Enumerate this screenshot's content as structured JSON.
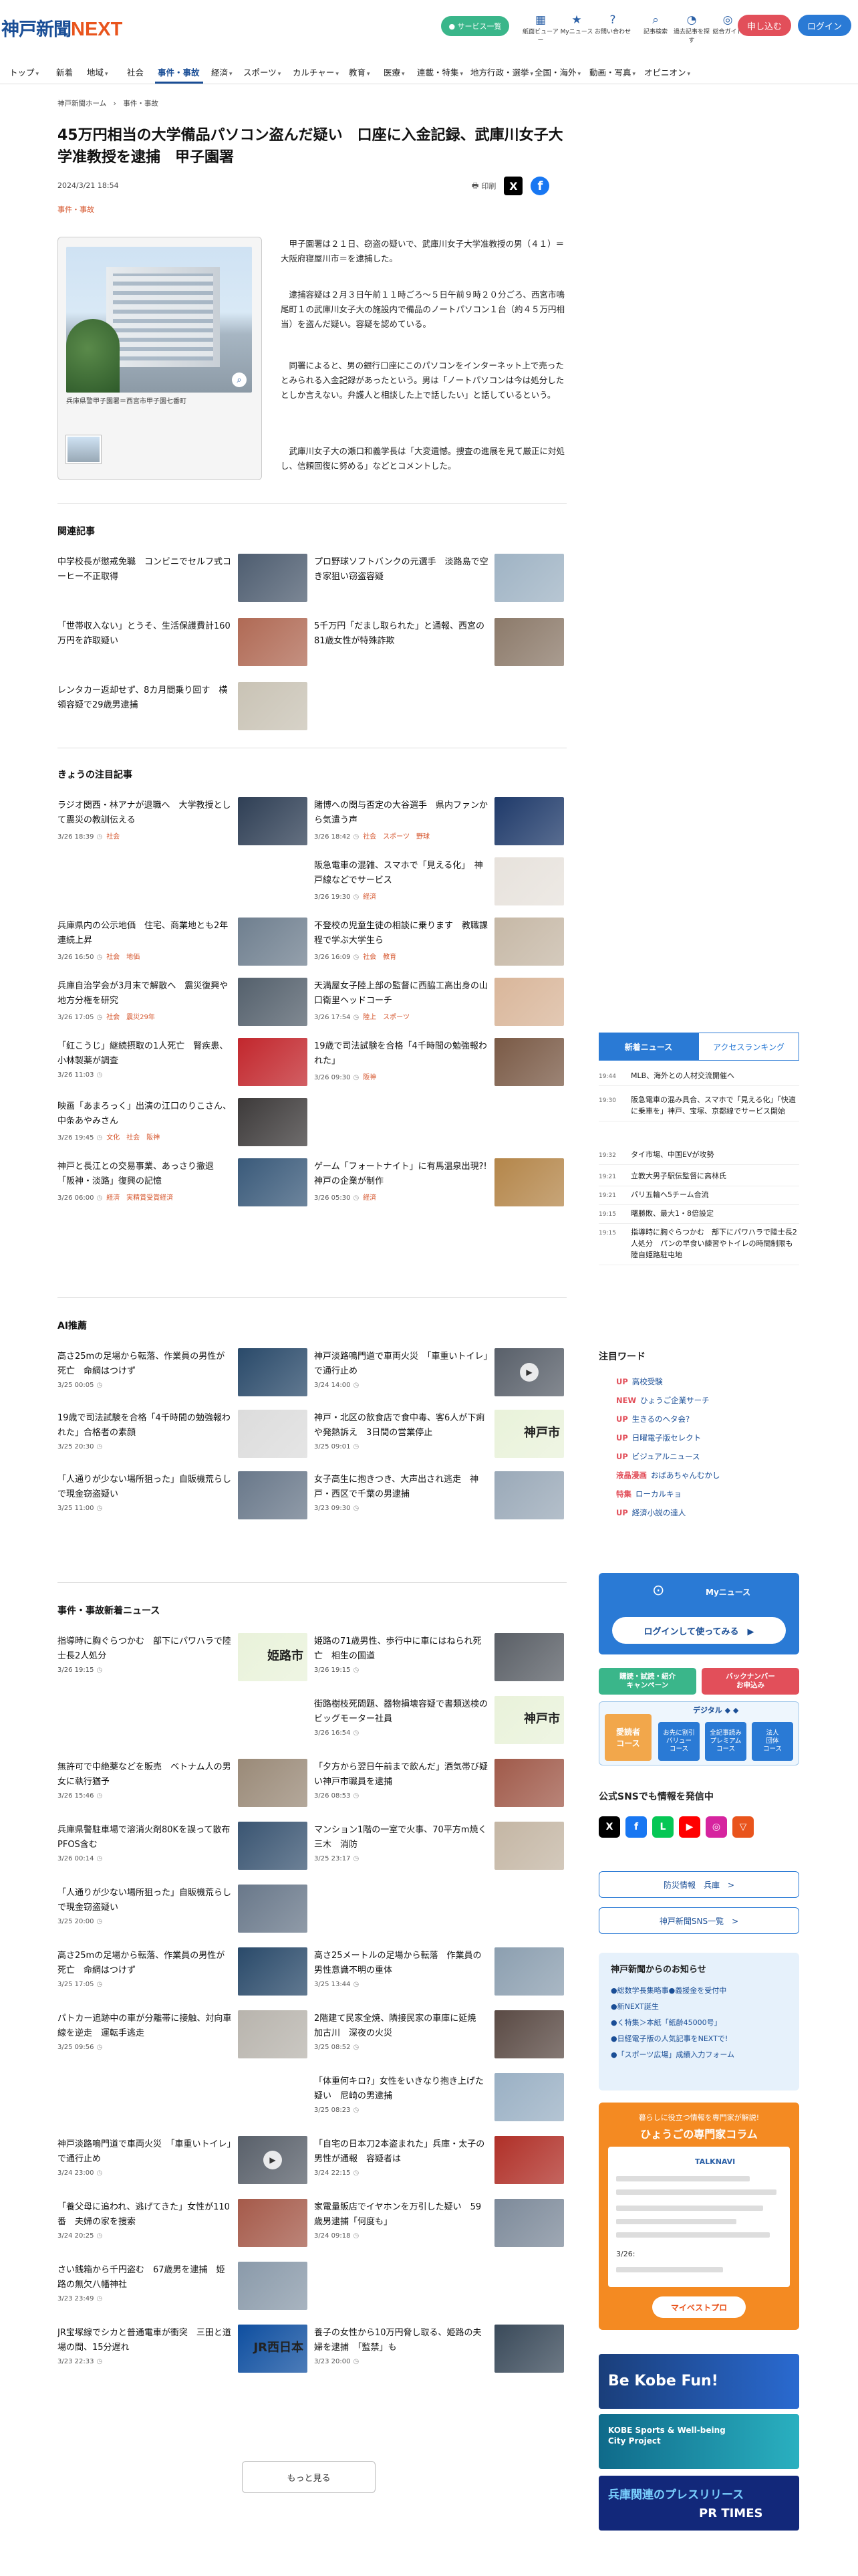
{
  "header": {
    "logo_text": "神戸新聞",
    "logo_next": "NEXT",
    "service_pill": "● サービス一覧",
    "icons": [
      {
        "glyph": "▦",
        "label": "紙面ビューアー"
      },
      {
        "glyph": "★",
        "label": "Myニュース"
      },
      {
        "glyph": "?",
        "label": "お問い合わせ"
      },
      {
        "glyph": "⌕",
        "label": "記事検索"
      },
      {
        "glyph": "◔",
        "label": "過去記事を探す"
      },
      {
        "glyph": "◎",
        "label": "総合ガイド"
      }
    ],
    "apply_label": "申し込む",
    "login_label": "ログイン"
  },
  "nav": {
    "items": [
      {
        "label": "トップ",
        "chev": "▾"
      },
      {
        "label": "新着",
        "chev": ""
      },
      {
        "label": "地域",
        "chev": "▾"
      },
      {
        "label": "社会",
        "chev": ""
      },
      {
        "label": "事件・事故",
        "chev": ""
      },
      {
        "label": "経済",
        "chev": "▾"
      },
      {
        "label": "スポーツ",
        "chev": "▾"
      },
      {
        "label": "カルチャー",
        "chev": "▾"
      },
      {
        "label": "教育",
        "chev": "▾"
      },
      {
        "label": "医療",
        "chev": "▾"
      },
      {
        "label": "連載・特集",
        "chev": "▾"
      },
      {
        "label": "地方行政・選挙",
        "chev": "▾"
      },
      {
        "label": "全国・海外",
        "chev": "▾"
      },
      {
        "label": "動画・写真",
        "chev": "▾"
      },
      {
        "label": "オピニオン",
        "chev": "▾"
      }
    ],
    "active_index": 4
  },
  "breadcrumb": "神戸新聞ホーム　›　事件・事故",
  "article": {
    "title": "45万円相当の大学備品パソコン盗んだ疑い　口座に入金記録、武庫川女子大学准教授を逮捕　甲子園署",
    "date": "2024/3/21 18:54",
    "category": "事件・事故",
    "print_label": "印刷",
    "photo_caption": "兵庫県警甲子園署＝西宮市甲子園七番町",
    "paragraphs": [
      "甲子園署は２１日、窃盗の疑いで、武庫川女子大学准教授の男（４１）＝大阪府寝屋川市＝を逮捕した。",
      "逮捕容疑は２月３日午前１１時ごろ～５日午前９時２０分ごろ、西宮市鳴尾町１の武庫川女子大の施設内で備品のノートパソコン１台（約４５万円相当）を盗んだ疑い。容疑を認めている。",
      "同署によると、男の銀行口座にこのパソコンをインターネット上で売ったとみられる入金記録があったという。男は「ノートパソコンは今は処分したとしか言えない。弁護人と相談した上で話したい」と話しているという。",
      "武庫川女子大の瀬口和義学長は「大変遺憾。捜査の進展を見て厳正に対処し、信頼回復に努める」などとコメントした。"
    ]
  },
  "sections": {
    "related": {
      "title": "関連記事",
      "cards": [
        {
          "title": "中学校長が懲戒免職　コンビニでセルフ式コーヒー不正取得",
          "meta": "",
          "tags": "",
          "img": "#4e5d70"
        },
        {
          "title": "プロ野球ソフトバンクの元選手　淡路島で空き家狙い窃盗容疑",
          "meta": "",
          "tags": "",
          "img": "#9fb3c4"
        },
        {
          "title": "「世帯収入ない」とうそ、生活保護費計160万円を詐取疑い",
          "meta": "",
          "tags": "",
          "img": "#b06a55"
        },
        {
          "title": "5千万円「だまし取られた」と通報、西宮の81歳女性が特殊詐欺",
          "meta": "",
          "tags": "",
          "img": "#8c7a6a"
        },
        {
          "title": "レンタカー返却せず、8カ月間乗り回す　横領容疑で29歳男逮捕",
          "meta": "",
          "tags": "",
          "img": "#c9c3b5"
        }
      ]
    },
    "featured": {
      "title": "きょうの注目記事",
      "cards": [
        {
          "title": "ラジオ関西・林アナが退職へ　大学教授として震災の教訓伝える",
          "meta": "3/26 18:39",
          "tags": "社会",
          "img": "#2f3f55"
        },
        {
          "title": "賭博への関与否定の大谷選手　県内ファンから気遣う声",
          "meta": "3/26 18:42",
          "tags": "社会　スポーツ　野球",
          "img": "#1f3a6a"
        },
        {
          "title": "",
          "meta": "",
          "tags": "",
          "img": ""
        },
        {
          "title": "阪急電車の混雑、スマホで「見える化」　神戸線などでサービス",
          "meta": "3/26 19:30",
          "tags": "経済",
          "img": "#e7e2dc"
        },
        {
          "title": "兵庫県内の公示地価　住宅、商業地とも2年連続上昇",
          "meta": "3/26 16:50",
          "tags": "社会　地価",
          "img": "#6f7f8f"
        },
        {
          "title": "不登校の児童生徒の相談に乗ります　教職課程で学ぶ大学生ら",
          "meta": "3/26 16:09",
          "tags": "社会　教育",
          "img": "#c6b8a6"
        },
        {
          "title": "兵庫自治学会が3月末で解散へ　震災復興や地方分権を研究",
          "meta": "3/26 17:05",
          "tags": "社会　震災29年",
          "img": "#54606c"
        },
        {
          "title": "天満屋女子陸上部の監督に西脇工高出身の山口衛里ヘッドコーチ",
          "meta": "3/26 17:54",
          "tags": "陸上　スポーツ",
          "img": "#d9b69a"
        },
        {
          "title": "「紅こうじ」継続摂取の1人死亡　腎疾患、小林製薬が調査",
          "meta": "3/26 11:03",
          "tags": "",
          "img": "#c2272d"
        },
        {
          "title": "19歳で司法試験を合格「4千時間の勉強報われた」",
          "meta": "3/26 09:30",
          "tags": "阪神",
          "img": "#7a5a46"
        },
        {
          "title": "映画「あまろっく」出演の江口のりこさん、中条あやみさん",
          "meta": "3/26 19:45",
          "tags": "文化　社会　阪神",
          "img": "#3d3a3a"
        },
        {
          "title": "",
          "meta": "",
          "tags": "",
          "img": ""
        },
        {
          "title": "神戸と長江との交易事業、あっさり撤退　「阪神・淡路」復興の記憶",
          "meta": "3/26 06:00",
          "tags": "経済　実精賞受賞経済",
          "img": "#3a5a7a"
        },
        {
          "title": "ゲーム「フォートナイト」に有馬温泉出現?!　神戸の企業が制作",
          "meta": "3/26 05:30",
          "tags": "経済",
          "img": "#b4864a"
        }
      ]
    },
    "ai": {
      "title": "AI推薦",
      "cards": [
        {
          "title": "高さ25mの足場から転落、作業員の男性が死亡　命綱はつけず",
          "meta": "3/25 00:05",
          "tags": "",
          "img": "#2a4a6a"
        },
        {
          "title": "神戸淡路鳴門道で車両火災　「車重いトイレ」で通行止め",
          "meta": "3/24 14:00",
          "tags": "",
          "img": "#59606a",
          "play": true
        },
        {
          "title": "19歳で司法試験を合格「4千時間の勉強報われた」合格者の素顔",
          "meta": "3/25 20:30",
          "tags": "",
          "img": "#dcdcdc"
        },
        {
          "title": "神戸・北区の飲食店で食中毒、客6人が下痢や発熱訴え　3日間の営業停止",
          "meta": "3/25 09:01",
          "tags": "",
          "img": "#e9f2da",
          "lbl": "神戸市"
        },
        {
          "title": "「人通りが少ない場所狙った」自販機荒らしで現金窃盗疑い",
          "meta": "3/25 11:00",
          "tags": "",
          "img": "#69788a"
        },
        {
          "title": "女子高生に抱きつき、大声出され逃走　神戸・西区で千葉の男逮捕",
          "meta": "3/23 09:30",
          "tags": "",
          "img": "#9aa9b8"
        }
      ]
    },
    "latest": {
      "title": "事件・事故新着ニュース",
      "cards": [
        {
          "title": "指導時に胸ぐらつかむ　部下にパワハラで陸士長2人処分",
          "meta": "3/26 19:15",
          "tags": "",
          "img": "#e9f2da",
          "lbl": "姫路市"
        },
        {
          "title": "姫路の71歳男性、歩行中に車にはねられ死亡　相生の国道",
          "meta": "3/26 19:15",
          "tags": "",
          "img": "#5a5f66"
        },
        {
          "title": "",
          "meta": "",
          "tags": "",
          "img": ""
        },
        {
          "title": "街路樹枝死問題、器物損壊容疑で書類送検のビッグモーター社員",
          "meta": "3/26 16:54",
          "tags": "",
          "img": "#e9f2da",
          "lbl": "神戸市"
        },
        {
          "title": "無許可で中絶薬などを販売　ベトナム人の男女に執行猶予",
          "meta": "3/26 15:46",
          "tags": "",
          "img": "#9a8a78"
        },
        {
          "title": "「夕方から翌日午前まで飲んだ」酒気帯び疑い神戸市職員を逮捕",
          "meta": "3/26 08:53",
          "tags": "",
          "img": "#a05a4a"
        },
        {
          "title": "兵庫県警駐車場で溶消火剤80Kを誤って散布　PFOS含む",
          "meta": "3/26 00:14",
          "tags": "",
          "img": "#3a5572"
        },
        {
          "title": "マンション1階の一室で火事、70平方m焼く　三木　消防",
          "meta": "3/25 23:17",
          "tags": "",
          "img": "#c4b6a4"
        },
        {
          "title": "「人通りが少ない場所狙った」自販機荒らしで現金窃盗疑い",
          "meta": "3/25 20:00",
          "tags": "",
          "img": "#69788a"
        },
        {
          "title": "",
          "meta": "",
          "tags": "",
          "img": ""
        },
        {
          "title": "高さ25mの足場から転落、作業員の男性が死亡　命綱はつけず",
          "meta": "3/25 17:05",
          "tags": "",
          "img": "#2a4a6a"
        },
        {
          "title": "高さ25メートルの足場から転落　作業員の男性意識不明の重体",
          "meta": "3/25 13:44",
          "tags": "",
          "img": "#8c9fb0"
        },
        {
          "title": "パトカー追跡中の車が分離帯に接触、対向車線を逆走　運転手逃走",
          "meta": "3/25 09:56",
          "tags": "",
          "img": "#b8b4ad"
        },
        {
          "title": "2階建て民家全焼、隣接民家の車庫に延焼　加古川　深夜の火災",
          "meta": "3/25 08:52",
          "tags": "",
          "img": "#5a4a44"
        },
        {
          "title": "",
          "meta": "",
          "tags": "",
          "img": ""
        },
        {
          "title": "「体重何キロ?」女性をいきなり抱き上げた疑い　尼崎の男逮捕",
          "meta": "3/25 08:23",
          "tags": "",
          "img": "#9ab0c4"
        },
        {
          "title": "神戸淡路鳴門道で車両火災　「車重いトイレ」で通行止め",
          "meta": "3/24 23:00",
          "tags": "",
          "img": "#59606a",
          "play": true
        },
        {
          "title": "「自宅の日本刀2本盗まれた」兵庫・太子の男性が通報　容疑者は",
          "meta": "3/24 22:15",
          "tags": "",
          "img": "#b03028"
        },
        {
          "title": "「養父母に追われ、逃げてきた」女性が110番　夫婦の家を捜索",
          "meta": "3/24 20:25",
          "tags": "",
          "img": "#a55a4a"
        },
        {
          "title": "家電量販店でイヤホンを万引した疑い　59歳男逮捕「何度も」",
          "meta": "3/24 09:18",
          "tags": "",
          "img": "#7d8a9a"
        },
        {
          "title": "さい銭箱から千円盗む　67歳男を逮捕　姫路の無欠八幡神社",
          "meta": "3/23 23:49",
          "tags": "",
          "img": "#8a9aaa"
        },
        {
          "title": "",
          "meta": "",
          "tags": "",
          "img": ""
        },
        {
          "title": "JR宝塚線でシカと普通電車が衝突　三田と道場の間、15分遅れ",
          "meta": "3/23 22:33",
          "tags": "",
          "img": "#0f4fa0",
          "lbl": "JR西日本"
        },
        {
          "title": "養子の女性から10万円脅し取る、姫路の夫婦を逮捕　「監禁」も",
          "meta": "3/23 20:00",
          "tags": "",
          "img": "#3a4a5a"
        }
      ]
    },
    "more_label": "もっと見る"
  },
  "sidebar": {
    "tabs": [
      "新着ニュース",
      "アクセスランキング"
    ],
    "news": [
      {
        "time": "19:44",
        "text": "MLB、海外との人材交流開催へ"
      },
      {
        "time": "19:30",
        "text": "阪急電車の混み具合、スマホで「見える化」「快適に乗車を」神戸、宝塚、京都線でサービス開始"
      },
      {
        "time": "19:32",
        "text": "タイ市場、中国EVが攻勢"
      },
      {
        "time": "19:21",
        "text": "立教大男子駅伝監督に高林氏"
      },
      {
        "time": "19:21",
        "text": "パリ五輪へ5チーム合流"
      },
      {
        "time": "19:15",
        "text": "曙勝敗、最大1・8倍設定"
      },
      {
        "time": "19:15",
        "text": "指導時に胸ぐらつかむ　部下にパワハラで陸士長2人処分　パンの早食い練習やトイレの時間制限も　陸自姫路駐屯地"
      }
    ],
    "words_title": "注目ワード",
    "words": [
      {
        "badge": "UP",
        "text": "高校受験"
      },
      {
        "badge": "NEW",
        "text": "ひょうご企業サーチ"
      },
      {
        "badge": "UP",
        "text": "生きるのヘタ会?"
      },
      {
        "badge": "UP",
        "text": "日曜電子版セレクト"
      },
      {
        "badge": "UP",
        "text": "ビジュアルニュース"
      },
      {
        "badge": "液晶漫画",
        "text": "おばあちゃんむかし"
      },
      {
        "badge": "特集",
        "text": "ローカルキョ"
      },
      {
        "badge": "UP",
        "text": "経済小説の達人"
      }
    ],
    "my_label": "Myニュース",
    "my_login": "ログインして使ってみる　▶",
    "promo1": "購読・試読・紹介\nキャンペーン",
    "promo2": "バックナンバー\nお申込み",
    "digital_head": "デジタル ◆ ◆",
    "digital_a": "愛読者\nコース",
    "digital_b": [
      "お先に割引\nバリュー\nコース",
      "全記事読み\nプレミアム\nコース",
      "法人\n団体\nコース"
    ],
    "sns_title": "公式SNSでも情報を発信中",
    "sns_icons": [
      {
        "name": "X",
        "color": "#000000"
      },
      {
        "name": "f",
        "color": "#1877f2"
      },
      {
        "name": "L",
        "color": "#06c755"
      },
      {
        "name": "▶",
        "color": "#ff0000"
      },
      {
        "name": "◎",
        "color": "#d6249f"
      },
      {
        "name": "▽",
        "color": "#e9541c"
      }
    ],
    "link1": "防災情報　兵庫　>",
    "link2": "神戸新聞SNS一覧　>",
    "info_title": "神戸新聞からのお知らせ",
    "info_items": [
      "●総数学長集略事●義援金を受付中",
      "●新NEXT誕生",
      "●く特集＞本紙「紙齢45000号」",
      "●日経電子版の人気記事をNEXTで!",
      "●「スポーツ広場」成績入力フォーム"
    ],
    "col_sub": "暮らしに役立つ情報を専門家が解説!",
    "col_title": "ひょうごの専門家コラム",
    "col_tv": "TALKNAVI",
    "col_date": "3/26:",
    "col_foot": "マイベストプロ",
    "banner1": "Be Kobe Fun!",
    "banner2": "KOBE Sports & Well-being City Project",
    "banner3": "兵庫関連のプレスリリース",
    "banner3b": "PR TIMES"
  }
}
